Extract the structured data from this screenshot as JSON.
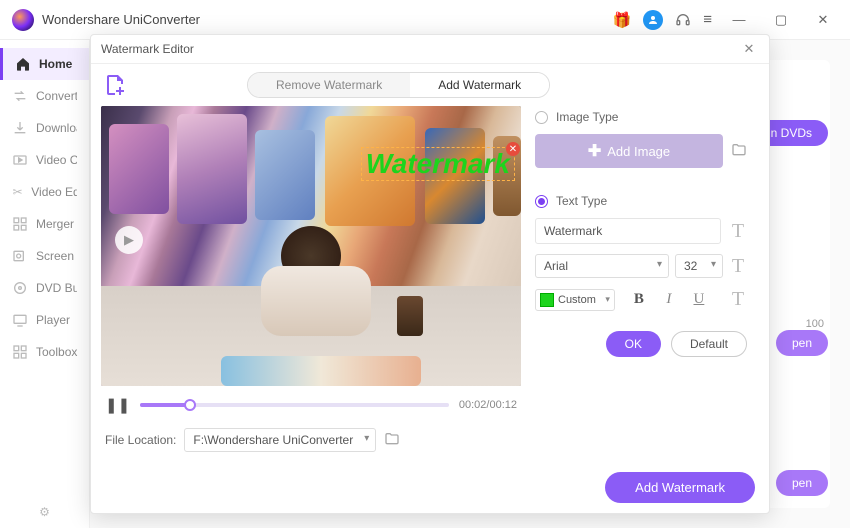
{
  "app": {
    "title": "Wondershare UniConverter"
  },
  "title_actions": {
    "minimize": "—",
    "maximize": "▢",
    "close": "✕"
  },
  "sidebar": {
    "items": [
      {
        "label": "Home"
      },
      {
        "label": "Converter"
      },
      {
        "label": "Downloader"
      },
      {
        "label": "Video Compressor"
      },
      {
        "label": "Video Editor"
      },
      {
        "label": "Merger"
      },
      {
        "label": "Screen Recorder"
      },
      {
        "label": "DVD Burner"
      },
      {
        "label": "Player"
      },
      {
        "label": "Toolbox"
      }
    ]
  },
  "background": {
    "burn_label": "n DVDs",
    "open1": "pen",
    "open2": "pen",
    "count": "100"
  },
  "modal": {
    "title": "Watermark Editor",
    "tabs": {
      "remove": "Remove Watermark",
      "add": "Add Watermark"
    },
    "preview": {
      "watermark_text": "Watermark",
      "time": "00:02/00:12"
    },
    "file_location": {
      "label": "File Location:",
      "value": "F:\\Wondershare UniConverter"
    },
    "settings": {
      "image_type_label": "Image Type",
      "add_image_label": "Add Image",
      "text_type_label": "Text Type",
      "text_value": "Watermark",
      "font": "Arial",
      "size": "32",
      "color_label": "Custom",
      "color_hex": "#1dd41d",
      "ok_label": "OK",
      "default_label": "Default"
    },
    "apply_label": "Add Watermark"
  }
}
